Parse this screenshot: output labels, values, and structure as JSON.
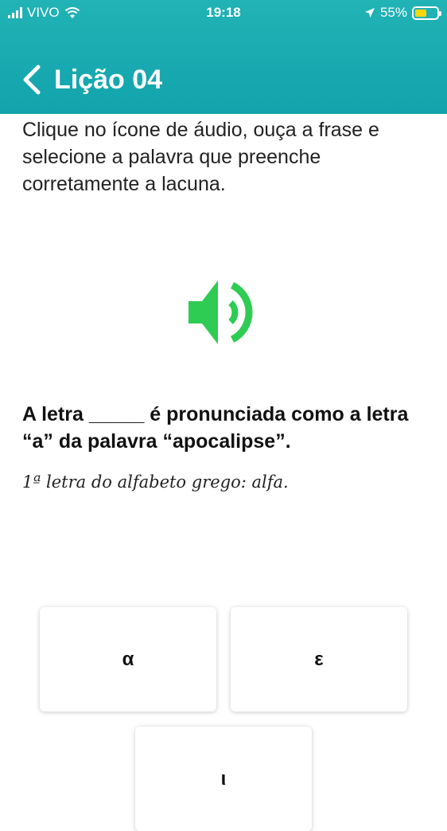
{
  "status": {
    "carrier": "VIVO",
    "time": "19:18",
    "battery": "55%",
    "battery_level": 0.55
  },
  "nav": {
    "title": "Lição 04"
  },
  "lesson": {
    "instructions": "Clique no ícone de áudio, ouça a frase e selecione a palavra que preenche corretamente a lacuna.",
    "sentence": "A letra _____ é pronunciada como a letra “a” da palavra “apocalipse”.",
    "hint": "1ª letra do alfabeto grego: alfa."
  },
  "options": [
    {
      "label": "α"
    },
    {
      "label": "ε"
    },
    {
      "label": "ι"
    }
  ],
  "colors": {
    "header": "#1aabb1",
    "audio_icon": "#2ecc52",
    "battery": "#ffd60a"
  },
  "icons": {
    "back": "chevron-left-icon",
    "audio": "speaker-icon",
    "location": "location-arrow-icon",
    "wifi": "wifi-icon",
    "signal": "signal-icon"
  }
}
